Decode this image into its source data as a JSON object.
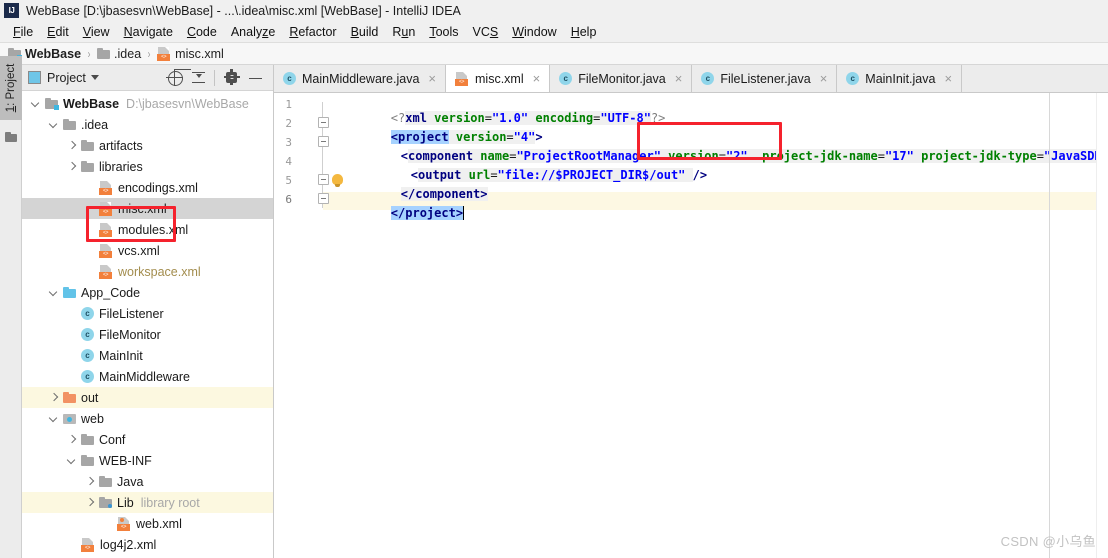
{
  "window": {
    "title": "WebBase [D:\\jbasesvn\\WebBase] - ...\\.idea\\misc.xml [WebBase] - IntelliJ IDEA",
    "app_icon": "IJ",
    "accent_color": "#f5222d"
  },
  "menubar": {
    "items": [
      {
        "label": "File",
        "mnemonic": "F"
      },
      {
        "label": "Edit",
        "mnemonic": "E"
      },
      {
        "label": "View",
        "mnemonic": "V"
      },
      {
        "label": "Navigate",
        "mnemonic": "N"
      },
      {
        "label": "Code",
        "mnemonic": "C"
      },
      {
        "label": "Analyze",
        "mnemonic": "z"
      },
      {
        "label": "Refactor",
        "mnemonic": "R"
      },
      {
        "label": "Build",
        "mnemonic": "B"
      },
      {
        "label": "Run",
        "mnemonic": "u"
      },
      {
        "label": "Tools",
        "mnemonic": "T"
      },
      {
        "label": "VCS",
        "mnemonic": "S"
      },
      {
        "label": "Window",
        "mnemonic": "W"
      },
      {
        "label": "Help",
        "mnemonic": "H"
      }
    ]
  },
  "breadcrumb": {
    "separator": "›",
    "items": [
      {
        "label": "WebBase",
        "icon": "module-folder-icon"
      },
      {
        "label": ".idea",
        "icon": "folder-icon"
      },
      {
        "label": "misc.xml",
        "icon": "xml-file-icon"
      }
    ]
  },
  "toolstrip": {
    "project_tab": "1: Project",
    "project_tab_mnemonic": "1"
  },
  "project_panel": {
    "toolbar": {
      "title": "Project",
      "buttons": [
        {
          "name": "select-opened-file-button",
          "icon": "locate-icon"
        },
        {
          "name": "collapse-all-button",
          "icon": "collapse-all-icon"
        },
        {
          "name": "settings-button",
          "icon": "gear-icon"
        },
        {
          "name": "hide-button",
          "icon": "minimize-icon"
        }
      ]
    },
    "tree": [
      {
        "label": "WebBase",
        "sub": "D:\\jbasesvn\\WebBase",
        "icon": "module-folder-icon",
        "indent": 0,
        "twisty": "open",
        "bold": true,
        "state": "normal"
      },
      {
        "label": ".idea",
        "sub": "",
        "icon": "folder-icon",
        "indent": 1,
        "twisty": "open",
        "bold": false,
        "state": "normal"
      },
      {
        "label": "artifacts",
        "sub": "",
        "icon": "folder-icon",
        "indent": 2,
        "twisty": "closed",
        "bold": false,
        "state": "normal"
      },
      {
        "label": "libraries",
        "sub": "",
        "icon": "folder-icon",
        "indent": 2,
        "twisty": "closed",
        "bold": false,
        "state": "normal"
      },
      {
        "label": "encodings.xml",
        "sub": "",
        "icon": "xml-file-icon",
        "indent": 3,
        "twisty": "none",
        "bold": false,
        "state": "normal"
      },
      {
        "label": "misc.xml",
        "sub": "",
        "icon": "xml-file-icon",
        "indent": 3,
        "twisty": "none",
        "bold": false,
        "state": "selected"
      },
      {
        "label": "modules.xml",
        "sub": "",
        "icon": "xml-file-icon",
        "indent": 3,
        "twisty": "none",
        "bold": false,
        "state": "normal"
      },
      {
        "label": "vcs.xml",
        "sub": "",
        "icon": "xml-file-icon",
        "indent": 3,
        "twisty": "none",
        "bold": false,
        "state": "normal"
      },
      {
        "label": "workspace.xml",
        "sub": "",
        "icon": "xml-file-icon",
        "indent": 3,
        "twisty": "none",
        "bold": false,
        "state": "muted"
      },
      {
        "label": "App_Code",
        "sub": "",
        "icon": "source-folder-icon",
        "indent": 1,
        "twisty": "open",
        "bold": false,
        "state": "normal"
      },
      {
        "label": "FileListener",
        "sub": "",
        "icon": "java-class-icon",
        "indent": 2,
        "twisty": "none",
        "bold": false,
        "state": "normal"
      },
      {
        "label": "FileMonitor",
        "sub": "",
        "icon": "java-class-icon",
        "indent": 2,
        "twisty": "none",
        "bold": false,
        "state": "normal"
      },
      {
        "label": "MainInit",
        "sub": "",
        "icon": "java-class-icon",
        "indent": 2,
        "twisty": "none",
        "bold": false,
        "state": "normal"
      },
      {
        "label": "MainMiddleware",
        "sub": "",
        "icon": "java-class-icon",
        "indent": 2,
        "twisty": "none",
        "bold": false,
        "state": "normal"
      },
      {
        "label": "out",
        "sub": "",
        "icon": "excluded-folder-icon",
        "indent": 1,
        "twisty": "closed",
        "bold": false,
        "state": "highlighted"
      },
      {
        "label": "web",
        "sub": "",
        "icon": "web-folder-icon",
        "indent": 1,
        "twisty": "open",
        "bold": false,
        "state": "normal"
      },
      {
        "label": "Conf",
        "sub": "",
        "icon": "folder-icon",
        "indent": 2,
        "twisty": "closed",
        "bold": false,
        "state": "normal"
      },
      {
        "label": "WEB-INF",
        "sub": "",
        "icon": "folder-icon",
        "indent": 2,
        "twisty": "open",
        "bold": false,
        "state": "normal"
      },
      {
        "label": "Java",
        "sub": "",
        "icon": "folder-icon",
        "indent": 3,
        "twisty": "closed",
        "bold": false,
        "state": "normal"
      },
      {
        "label": "Lib",
        "sub": "library root",
        "icon": "library-folder-icon",
        "indent": 3,
        "twisty": "closed",
        "bold": false,
        "state": "highlighted"
      },
      {
        "label": "web.xml",
        "sub": "",
        "icon": "web-xml-file-icon",
        "indent": 4,
        "twisty": "none",
        "bold": false,
        "state": "normal"
      },
      {
        "label": "log4j2.xml",
        "sub": "",
        "icon": "xml-file-icon",
        "indent": 2,
        "twisty": "none",
        "bold": false,
        "state": "normal"
      }
    ]
  },
  "editor": {
    "tabs": [
      {
        "label": "MainMiddleware.java",
        "icon": "java-class-icon",
        "active": false,
        "close": "×"
      },
      {
        "label": "misc.xml",
        "icon": "xml-file-icon",
        "active": true,
        "close": "×"
      },
      {
        "label": "FileMonitor.java",
        "icon": "java-class-icon",
        "active": false,
        "close": "×"
      },
      {
        "label": "FileListener.java",
        "icon": "java-class-icon",
        "active": false,
        "close": "×"
      },
      {
        "label": "MainInit.java",
        "icon": "java-class-icon",
        "active": false,
        "close": "×"
      }
    ],
    "line_numbers": [
      "1",
      "2",
      "3",
      "4",
      "5",
      "6"
    ],
    "current_line": 6,
    "lines": {
      "l1_pi_open": "<?",
      "l1_pi_name": "xml",
      "l1_attr1": "version",
      "l1_val1": "\"1.0\"",
      "l1_attr2": "encoding",
      "l1_val2": "\"UTF-8\"",
      "l1_pi_close": "?>",
      "l2_lt": "<",
      "l2_tag": "project",
      "l2_attr1": "version",
      "l2_val1": "\"4\"",
      "l2_gt": ">",
      "l3_lt": "<",
      "l3_tag": "component",
      "l3_attr1": "name",
      "l3_val1": "\"ProjectRootManager\"",
      "l3_attr2": "version",
      "l3_val2": "\"2\"",
      "l3_attr3": "project-jdk-name",
      "l3_val3": "\"17\"",
      "l3_attr4": "project-jdk-type",
      "l3_val4": "\"JavaSDK\"",
      "l3_gt": ">",
      "l4_lt": "<",
      "l4_tag": "output",
      "l4_attr1": "url",
      "l4_val1": "\"file://$PROJECT_DIR$/out\"",
      "l4_gt": "/>",
      "l5_close": "</component>",
      "l6_close": "</project>"
    }
  },
  "annotations": {
    "tree_box_target": "misc.xml",
    "code_box_target": "project-jdk-name=\"17\""
  },
  "watermark": {
    "text": "CSDN @小乌鱼"
  }
}
